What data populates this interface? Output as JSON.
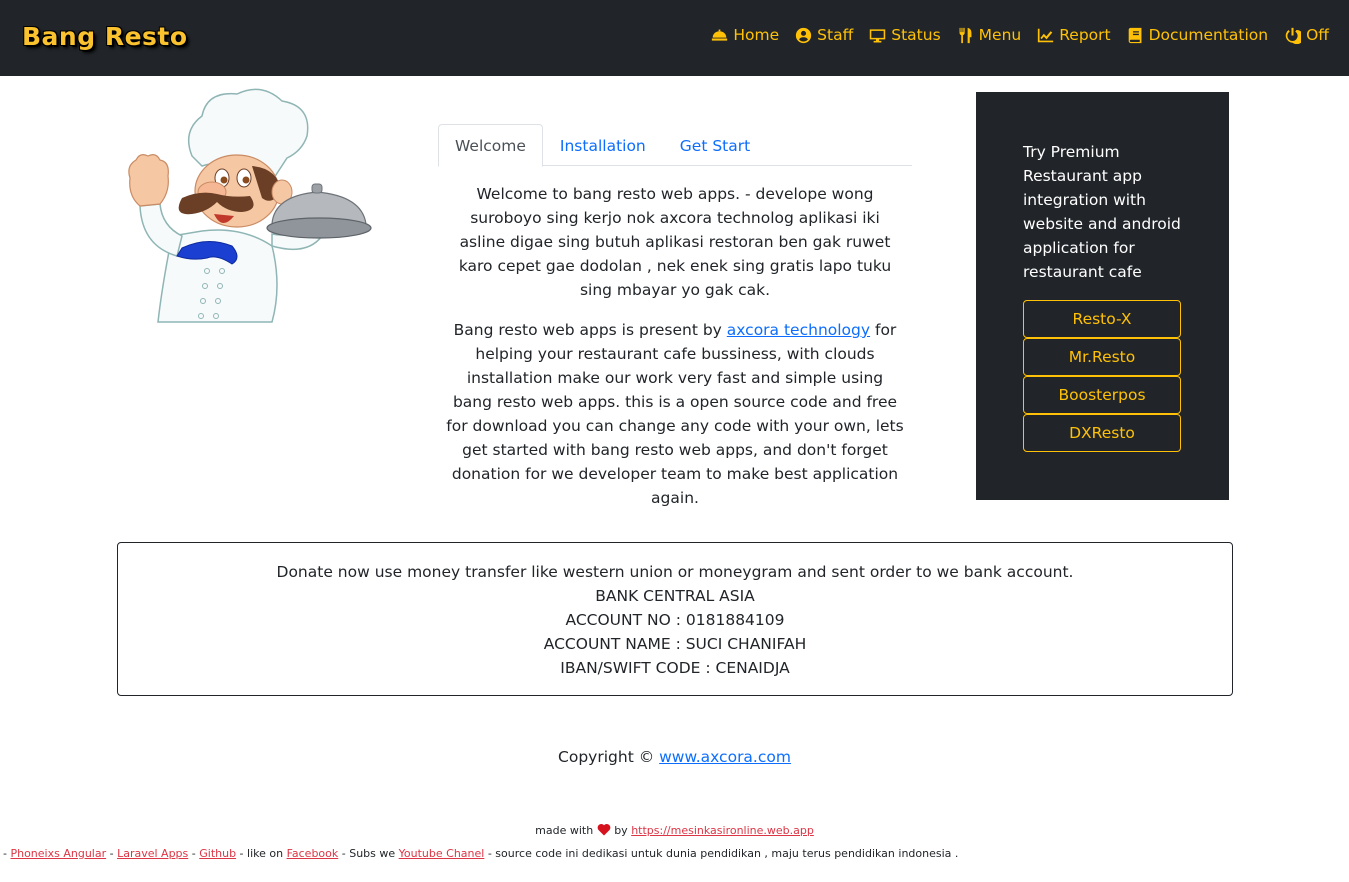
{
  "navbar": {
    "brand": "Bang Resto",
    "items": [
      {
        "label": "Home",
        "icon": "bell-concierge-icon"
      },
      {
        "label": "Staff",
        "icon": "user-circle-icon"
      },
      {
        "label": "Status",
        "icon": "desktop-icon"
      },
      {
        "label": "Menu",
        "icon": "utensils-icon"
      },
      {
        "label": "Report",
        "icon": "chart-line-icon"
      },
      {
        "label": "Documentation",
        "icon": "book-icon"
      },
      {
        "label": "Off",
        "icon": "power-off-icon"
      }
    ]
  },
  "tabs": [
    {
      "label": "Welcome",
      "active": true
    },
    {
      "label": "Installation",
      "active": false
    },
    {
      "label": "Get Start",
      "active": false
    }
  ],
  "welcome": {
    "paragraph1": "Welcome to bang resto web apps. - develope wong suroboyo sing kerjo nok axcora technolog aplikasi iki asline digae sing butuh aplikasi restoran ben gak ruwet karo cepet gae dodolan , nek enek sing gratis lapo tuku sing mbayar yo gak cak.",
    "paragraph2_before": "Bang resto web apps is present by ",
    "paragraph2_link": "axcora technology",
    "paragraph2_after": " for helping your restaurant cafe bussiness, with clouds installation make our work very fast and simple using bang resto web apps. this is a open source code and free for download you can change any code with your own, lets get started with bang resto web apps, and don't forget donation for we developer team to make best application again."
  },
  "premium": {
    "text": "Try Premium Restaurant app integration with website and android application for restaurant cafe",
    "buttons": [
      "Resto-X",
      "Mr.Resto",
      "Boosterpos",
      "DXResto"
    ]
  },
  "donate": {
    "lines": [
      "Donate now use money transfer like western union or moneygram and sent order to we bank account.",
      "BANK CENTRAL ASIA",
      "ACCOUNT NO : 0181884109",
      "ACCOUNT NAME : SUCI CHANIFAH",
      "IBAN/SWIFT CODE : CENAIDJA"
    ]
  },
  "copyright": {
    "prefix": "Copyright © ",
    "link": "www.axcora.com"
  },
  "footer": {
    "made_with": "made with",
    "by": "by",
    "made_link": "https://mesinkasironline.web.app",
    "sep": " - ",
    "link_phoenix": "Phoneixs Angular",
    "link_laravel": "Laravel Apps",
    "link_github": "Github",
    "like_on": " - like on ",
    "link_facebook": "Facebook",
    "subs_we": " - Subs we ",
    "link_youtube": "Youtube Chanel",
    "tail": " - source code ini dedikasi untuk dunia pendidikan , maju terus pendidikan indonesia ."
  },
  "colors": {
    "navbar_bg": "#212529",
    "accent_yellow": "#ffc107",
    "link_blue": "#0d6efd",
    "footer_link_red": "#dc3545"
  }
}
